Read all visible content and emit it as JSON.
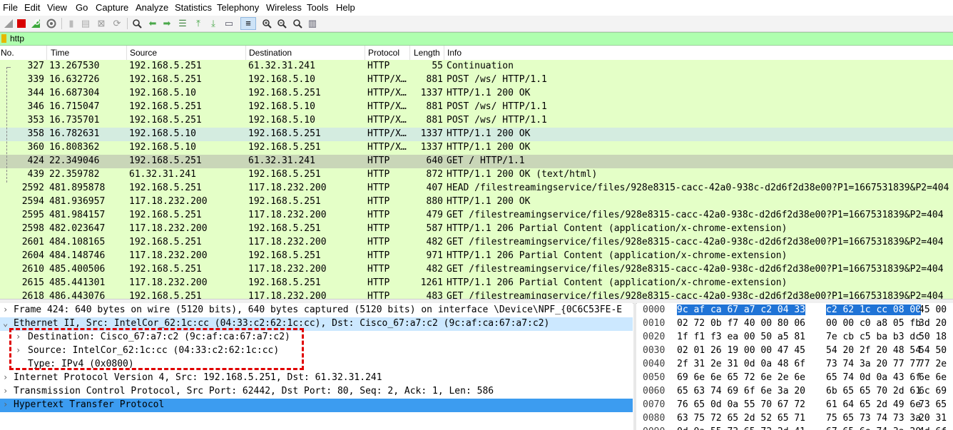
{
  "menu": [
    "File",
    "Edit",
    "View",
    "Go",
    "Capture",
    "Analyze",
    "Statistics",
    "Telephony",
    "Wireless",
    "Tools",
    "Help"
  ],
  "toolbar": {
    "icons": [
      "shark-fin-icon",
      "stop-icon",
      "restart-icon",
      "options-icon",
      "open-icon",
      "file-icon",
      "close-file-icon",
      "reload-icon",
      "find-icon",
      "back-icon",
      "forward-icon",
      "goto-icon",
      "first-icon",
      "last-icon",
      "autoscroll-icon",
      "colorize-icon",
      "zoom-in-icon",
      "zoom-out-icon",
      "normal-size-icon",
      "resize-columns-icon"
    ]
  },
  "filter": {
    "value": "http"
  },
  "columns": [
    "No.",
    "Time",
    "Source",
    "Destination",
    "Protocol",
    "Length",
    "Info"
  ],
  "packets": [
    {
      "no": "327",
      "time": "13.267530",
      "src": "192.168.5.251",
      "dst": "61.32.31.241",
      "proto": "HTTP",
      "len": "55",
      "info": "Continuation"
    },
    {
      "no": "339",
      "time": "16.632726",
      "src": "192.168.5.251",
      "dst": "192.168.5.10",
      "proto": "HTTP/X…",
      "len": "881",
      "info": "POST /ws/ HTTP/1.1"
    },
    {
      "no": "344",
      "time": "16.687304",
      "src": "192.168.5.10",
      "dst": "192.168.5.251",
      "proto": "HTTP/X…",
      "len": "1337",
      "info": "HTTP/1.1 200 OK"
    },
    {
      "no": "346",
      "time": "16.715047",
      "src": "192.168.5.251",
      "dst": "192.168.5.10",
      "proto": "HTTP/X…",
      "len": "881",
      "info": "POST /ws/ HTTP/1.1"
    },
    {
      "no": "353",
      "time": "16.735701",
      "src": "192.168.5.251",
      "dst": "192.168.5.10",
      "proto": "HTTP/X…",
      "len": "881",
      "info": "POST /ws/ HTTP/1.1"
    },
    {
      "no": "358",
      "time": "16.782631",
      "src": "192.168.5.10",
      "dst": "192.168.5.251",
      "proto": "HTTP/X…",
      "len": "1337",
      "info": "HTTP/1.1 200 OK"
    },
    {
      "no": "360",
      "time": "16.808362",
      "src": "192.168.5.10",
      "dst": "192.168.5.251",
      "proto": "HTTP/X…",
      "len": "1337",
      "info": "HTTP/1.1 200 OK"
    },
    {
      "no": "424",
      "time": "22.349046",
      "src": "192.168.5.251",
      "dst": "61.32.31.241",
      "proto": "HTTP",
      "len": "640",
      "info": "GET / HTTP/1.1"
    },
    {
      "no": "439",
      "time": "22.359782",
      "src": "61.32.31.241",
      "dst": "192.168.5.251",
      "proto": "HTTP",
      "len": "872",
      "info": "HTTP/1.1 200 OK  (text/html)"
    },
    {
      "no": "2592",
      "time": "481.895878",
      "src": "192.168.5.251",
      "dst": "117.18.232.200",
      "proto": "HTTP",
      "len": "407",
      "info": "HEAD /filestreamingservice/files/928e8315-cacc-42a0-938c-d2d6f2d38e00?P1=1667531839&P2=404"
    },
    {
      "no": "2594",
      "time": "481.936957",
      "src": "117.18.232.200",
      "dst": "192.168.5.251",
      "proto": "HTTP",
      "len": "880",
      "info": "HTTP/1.1 200 OK"
    },
    {
      "no": "2595",
      "time": "481.984157",
      "src": "192.168.5.251",
      "dst": "117.18.232.200",
      "proto": "HTTP",
      "len": "479",
      "info": "GET /filestreamingservice/files/928e8315-cacc-42a0-938c-d2d6f2d38e00?P1=1667531839&P2=404"
    },
    {
      "no": "2598",
      "time": "482.023647",
      "src": "117.18.232.200",
      "dst": "192.168.5.251",
      "proto": "HTTP",
      "len": "587",
      "info": "HTTP/1.1 206 Partial Content  (application/x-chrome-extension)"
    },
    {
      "no": "2601",
      "time": "484.108165",
      "src": "192.168.5.251",
      "dst": "117.18.232.200",
      "proto": "HTTP",
      "len": "482",
      "info": "GET /filestreamingservice/files/928e8315-cacc-42a0-938c-d2d6f2d38e00?P1=1667531839&P2=404"
    },
    {
      "no": "2604",
      "time": "484.148746",
      "src": "117.18.232.200",
      "dst": "192.168.5.251",
      "proto": "HTTP",
      "len": "971",
      "info": "HTTP/1.1 206 Partial Content  (application/x-chrome-extension)"
    },
    {
      "no": "2610",
      "time": "485.400506",
      "src": "192.168.5.251",
      "dst": "117.18.232.200",
      "proto": "HTTP",
      "len": "482",
      "info": "GET /filestreamingservice/files/928e8315-cacc-42a0-938c-d2d6f2d38e00?P1=1667531839&P2=404"
    },
    {
      "no": "2615",
      "time": "485.441301",
      "src": "117.18.232.200",
      "dst": "192.168.5.251",
      "proto": "HTTP",
      "len": "1261",
      "info": "HTTP/1.1 206 Partial Content  (application/x-chrome-extension)"
    },
    {
      "no": "2618",
      "time": "486.443076",
      "src": "192.168.5.251",
      "dst": "117.18.232.200",
      "proto": "HTTP",
      "len": "483",
      "info": "GET /filestreamingservice/files/928e8315-cacc-42a0-938c-d2d6f2d38e00?P1=1667531839&P2=404"
    }
  ],
  "details": [
    {
      "text": "Frame 424: 640 bytes on wire (5120 bits), 640 bytes captured (5120 bits) on interface \\Device\\NPF_{0C6C53FE-E",
      "arrow": "›",
      "indent": 0
    },
    {
      "text": "Ethernet II, Src: IntelCor_62:1c:cc (04:33:c2:62:1c:cc), Dst: Cisco_67:a7:c2 (9c:af:ca:67:a7:c2)",
      "arrow": "⌄",
      "indent": 0
    },
    {
      "text": "Destination: Cisco_67:a7:c2 (9c:af:ca:67:a7:c2)",
      "arrow": "›",
      "indent": 1
    },
    {
      "text": "Source: IntelCor_62:1c:cc (04:33:c2:62:1c:cc)",
      "arrow": "›",
      "indent": 1
    },
    {
      "text": "Type: IPv4 (0x0800)",
      "arrow": "",
      "indent": 1
    },
    {
      "text": "Internet Protocol Version 4, Src: 192.168.5.251, Dst: 61.32.31.241",
      "arrow": "›",
      "indent": 0
    },
    {
      "text": "Transmission Control Protocol, Src Port: 62442, Dst Port: 80, Seq: 2, Ack: 1, Len: 586",
      "arrow": "›",
      "indent": 0
    },
    {
      "text": "Hypertext Transfer Protocol",
      "arrow": "›",
      "indent": 0
    }
  ],
  "hex": [
    {
      "off": "0000",
      "a": "9c af ca 67 a7 c2 04 33",
      "b": "c2 62 1c cc 08 00",
      "c": "45 00"
    },
    {
      "off": "0010",
      "a": "02 72 0b f7 40 00 80 06",
      "b": "00 00 c0 a8 05 fb",
      "c": "3d 20"
    },
    {
      "off": "0020",
      "a": "1f f1 f3 ea 00 50 a5 81",
      "b": "7e cb c5 ba b3 dc",
      "c": "50 18"
    },
    {
      "off": "0030",
      "a": "02 01 26 19 00 00 47 45",
      "b": "54 20 2f 20 48 54",
      "c": "54 50"
    },
    {
      "off": "0040",
      "a": "2f 31 2e 31 0d 0a 48 6f",
      "b": "73 74 3a 20 77 77",
      "c": "77 2e"
    },
    {
      "off": "0050",
      "a": "69 6e 6e 65 72 6e 2e 6e",
      "b": "65 74 0d 0a 43 6f",
      "c": "6e 6e"
    },
    {
      "off": "0060",
      "a": "65 63 74 69 6f 6e 3a 20",
      "b": "6b 65 65 70 2d 61",
      "c": "6c 69"
    },
    {
      "off": "0070",
      "a": "76 65 0d 0a 55 70 67 72",
      "b": "61 64 65 2d 49 6e",
      "c": "73 65"
    },
    {
      "off": "0080",
      "a": "63 75 72 65 2d 52 65 71",
      "b": "75 65 73 74 73 3a",
      "c": "20 31"
    },
    {
      "off": "0090",
      "a": "0d 0a 55 73 65 72 2d 41",
      "b": "67 65 6e 74 3a 20",
      "c": "4d 6f"
    }
  ]
}
